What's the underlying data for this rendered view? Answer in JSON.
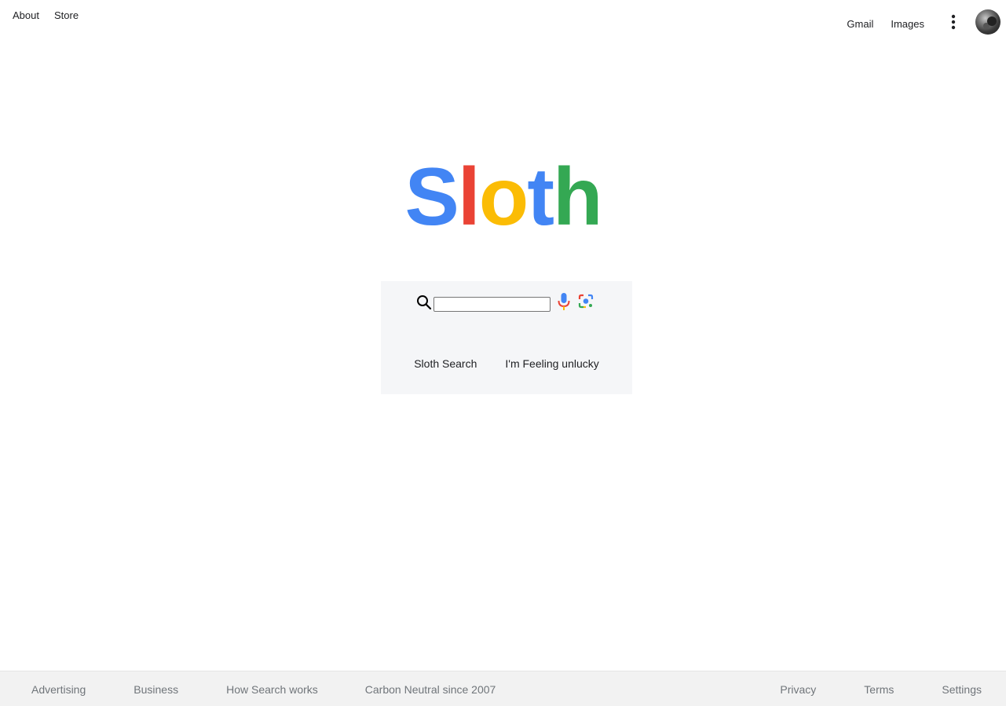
{
  "header": {
    "left_links": [
      "About",
      "Store"
    ],
    "gmail": "Gmail",
    "images": "Images"
  },
  "logo": {
    "letters": [
      {
        "char": "S",
        "color": "#4285F4"
      },
      {
        "char": "l",
        "color": "#EA4335"
      },
      {
        "char": "o",
        "color": "#FBBC05"
      },
      {
        "char": "t",
        "color": "#4285F4"
      },
      {
        "char": "h",
        "color": "#34A853"
      }
    ]
  },
  "search": {
    "value": "",
    "search_button": "Sloth Search",
    "lucky_button": "I'm Feeling unlucky"
  },
  "footer": {
    "left": [
      "Advertising",
      "Business",
      "How Search works",
      "Carbon Neutral since 2007"
    ],
    "right": [
      "Privacy",
      "Terms",
      "Settings"
    ]
  },
  "icons": {
    "search": "search-icon",
    "mic": "mic-icon",
    "lens": "camera-lens-icon",
    "apps": "more-vertical-icon",
    "avatar": "avatar"
  }
}
